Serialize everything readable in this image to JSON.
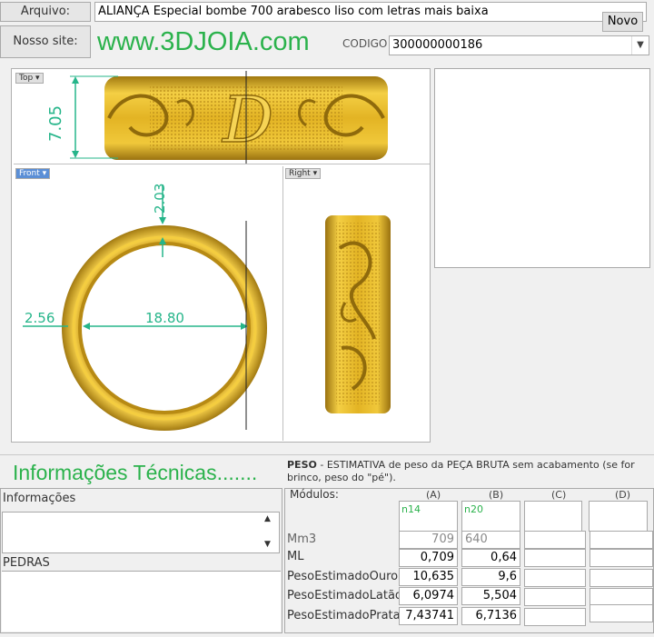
{
  "header": {
    "arquivo_label": "Arquivo:",
    "arquivo_value": "ALIANÇA Especial bombe 700 arabesco liso com letras mais baixa",
    "novo_button": "Novo",
    "site_label": "Nosso site:",
    "site_url": "www.3DJOIA.com",
    "codigo_label": "CODIGO",
    "codigo_value": "300000000186"
  },
  "views": {
    "top_label": "Top",
    "front_label": "Front",
    "right_label": "Right",
    "dim_height": "7.05",
    "dim_wall": "2.03",
    "dim_thickness": "2.56",
    "dim_diameter": "18.80",
    "engraved_letter": "D"
  },
  "tech": {
    "title": "Informações Técnicas.......",
    "peso_label": "PESO",
    "peso_desc": "-  ESTIMATIVA de peso da PEÇA BRUTA sem acabamento (se for brinco, peso do \"pé\").",
    "informacoes_label": "Informações",
    "pedras_label": "PEDRAS",
    "modulos_label": "Módulos:",
    "columns": [
      "(A)",
      "(B)",
      "(C)",
      "(D)"
    ],
    "module_values": [
      "n14",
      "n20",
      "",
      ""
    ],
    "rows": [
      {
        "label": "Mm3",
        "a": "709",
        "b": "640"
      },
      {
        "label": "ML",
        "a": "0,709",
        "b": "0,64"
      },
      {
        "label": "PesoEstimadoOuro",
        "a": "10,635",
        "b": "9,6"
      },
      {
        "label": "PesoEstimadoLatão",
        "a": "6,0974",
        "b": "5,504"
      },
      {
        "label": "PesoEstimadoPrata",
        "a": "7,43741",
        "b": "6,7136"
      }
    ]
  },
  "colors": {
    "green": "#2bb24c",
    "gold": "#e8b820",
    "dim_teal": "#26b58a"
  }
}
